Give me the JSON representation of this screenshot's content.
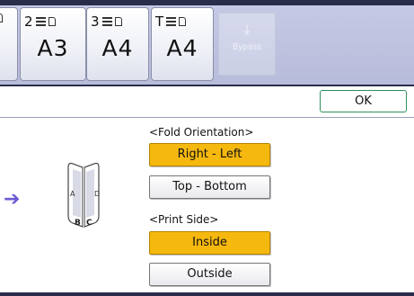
{
  "trays": [
    {
      "number": "",
      "size": ""
    },
    {
      "number": "2",
      "size": "A3"
    },
    {
      "number": "3",
      "size": "A4"
    },
    {
      "number": "T",
      "size": "A4"
    }
  ],
  "bypass": {
    "label": "Bypass"
  },
  "ok_label": "OK",
  "fold": {
    "heading": "<Fold Orientation>",
    "options": [
      "Right - Left",
      "Top - Bottom"
    ],
    "selected": "Right - Left"
  },
  "print_side": {
    "heading": "<Print Side>",
    "options": [
      "Inside",
      "Outside"
    ],
    "selected": "Inside"
  },
  "illustration": {
    "left": "A",
    "right": "D",
    "bottom_left": "B",
    "bottom_right": "C"
  },
  "colors": {
    "selected": "#f5b80f",
    "header_band": "#c5c9e4",
    "accent_arrow": "#6b5bd3"
  }
}
